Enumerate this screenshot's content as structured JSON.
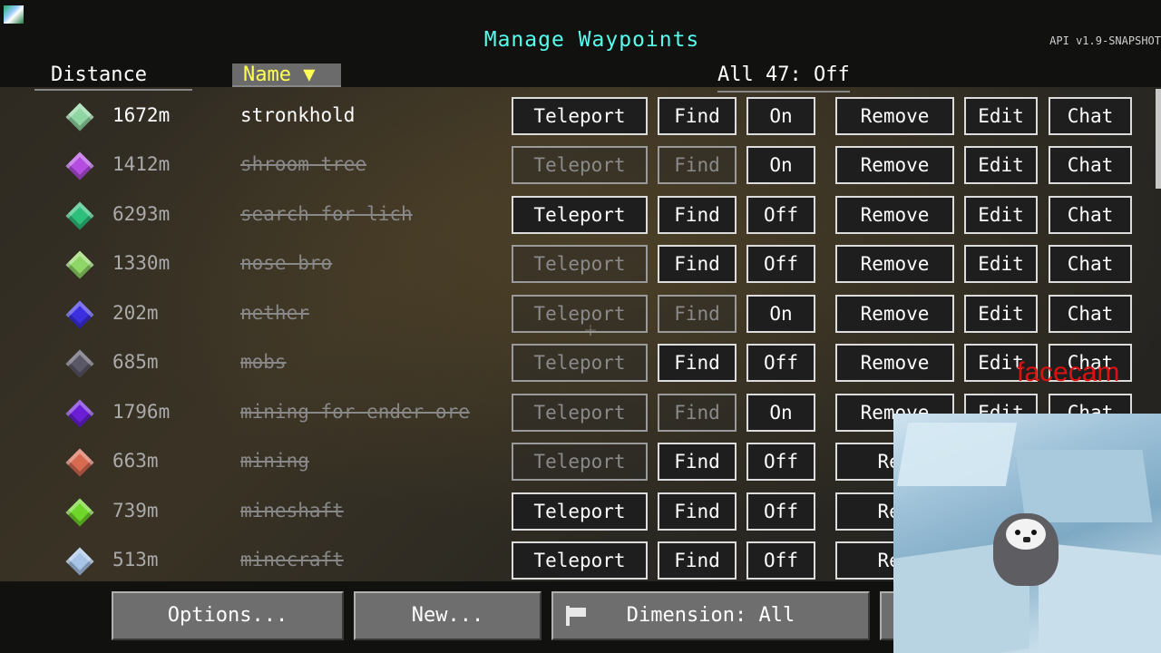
{
  "header": {
    "title": "Manage Waypoints",
    "version": "API v1.9-SNAPSHOT",
    "columns": {
      "distance": "Distance",
      "name": "Name ▼",
      "all": "All 47: Off"
    }
  },
  "colors": {
    "title": "#55ffee",
    "sort_header": "#ffff55",
    "facecam_label": "#e01010"
  },
  "waypoints": [
    {
      "distance": "1672m",
      "name": "stronkhold",
      "color": "#8fd6a2",
      "teleport": "Teleport",
      "find": "Find",
      "toggle": "On",
      "remove": "Remove",
      "edit": "Edit",
      "chat": "Chat"
    },
    {
      "distance": "1412m",
      "name": "shroom tree",
      "color": "#b44de0",
      "teleport": "Teleport",
      "find": "Find",
      "toggle": "On",
      "remove": "Remove",
      "edit": "Edit",
      "chat": "Chat"
    },
    {
      "distance": "6293m",
      "name": "search for lich",
      "color": "#2fbf7d",
      "teleport": "Teleport",
      "find": "Find",
      "toggle": "Off",
      "remove": "Remove",
      "edit": "Edit",
      "chat": "Chat"
    },
    {
      "distance": "1330m",
      "name": "nose bro",
      "color": "#8fd666",
      "teleport": "Teleport",
      "find": "Find",
      "toggle": "Off",
      "remove": "Remove",
      "edit": "Edit",
      "chat": "Chat"
    },
    {
      "distance": "202m",
      "name": "nether",
      "color": "#3b2fe0",
      "teleport": "Teleport",
      "find": "Find",
      "toggle": "On",
      "remove": "Remove",
      "edit": "Edit",
      "chat": "Chat"
    },
    {
      "distance": "685m",
      "name": "mobs",
      "color": "#5a5866",
      "teleport": "Teleport",
      "find": "Find",
      "toggle": "Off",
      "remove": "Remove",
      "edit": "Edit",
      "chat": "Chat"
    },
    {
      "distance": "1796m",
      "name": "mining for ender ore",
      "color": "#6a1fd6",
      "teleport": "Teleport",
      "find": "Find",
      "toggle": "On",
      "remove": "Remove",
      "edit": "Edit",
      "chat": "Chat"
    },
    {
      "distance": "663m",
      "name": "mining",
      "color": "#d86a52",
      "teleport": "Teleport",
      "find": "Find",
      "toggle": "Off",
      "remove": "Rem",
      "edit": "",
      "chat": ""
    },
    {
      "distance": "739m",
      "name": "mineshaft",
      "color": "#6fd62a",
      "teleport": "Teleport",
      "find": "Find",
      "toggle": "Off",
      "remove": "Rem",
      "edit": "",
      "chat": ""
    },
    {
      "distance": "513m",
      "name": "minecraft",
      "color": "#a8c4e8",
      "teleport": "Teleport",
      "find": "Find",
      "toggle": "Off",
      "remove": "Rem",
      "edit": "",
      "chat": ""
    }
  ],
  "footer": {
    "options": "Options...",
    "new": "New...",
    "dimension": "Dimension: All"
  },
  "facecam": {
    "label": "facecam"
  }
}
